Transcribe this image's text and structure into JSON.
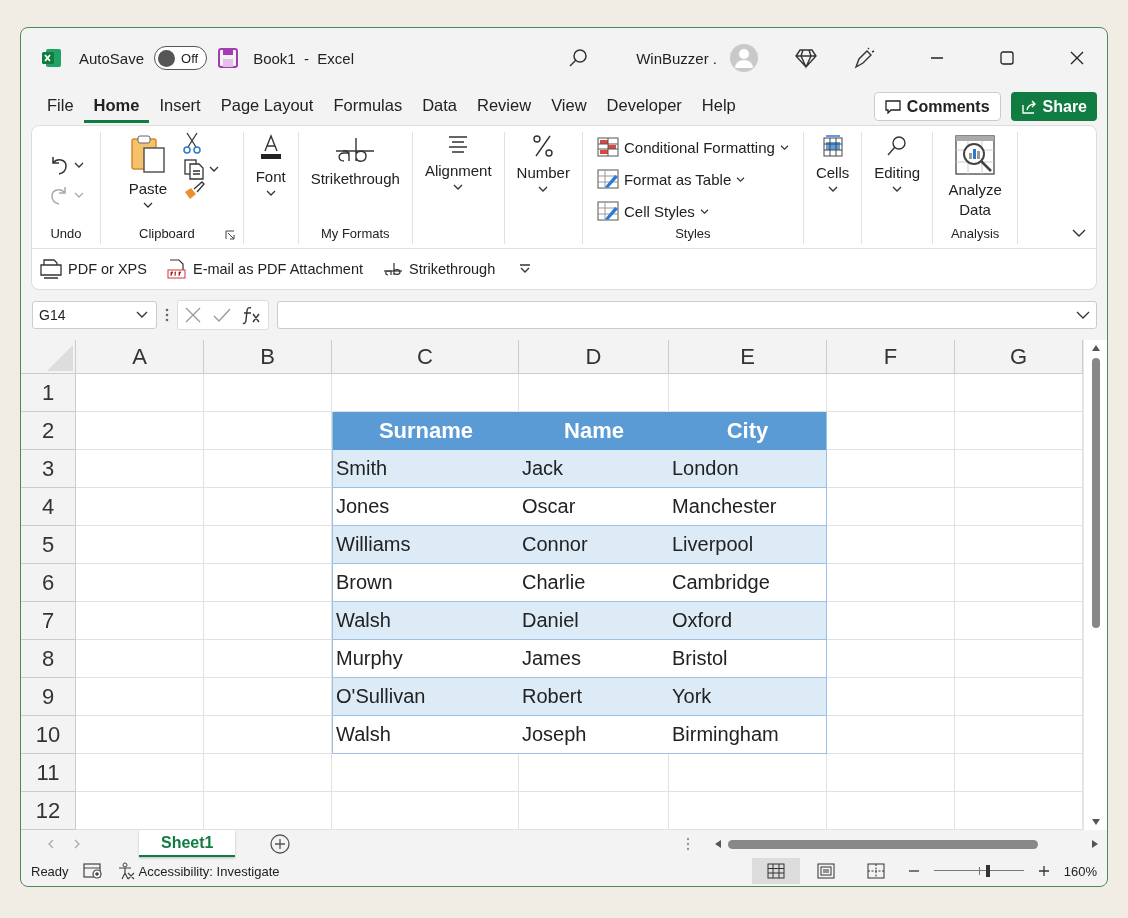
{
  "title_bar": {
    "autosave_label": "AutoSave",
    "autosave_on": false,
    "autosave_state": "Off",
    "document_title": "Book1  -  Excel",
    "account": "WinBuzzer ."
  },
  "menu_tabs": [
    {
      "label": "File",
      "selected": false
    },
    {
      "label": "Home",
      "selected": true
    },
    {
      "label": "Insert",
      "selected": false
    },
    {
      "label": "Page Layout",
      "selected": false
    },
    {
      "label": "Formulas",
      "selected": false
    },
    {
      "label": "Data",
      "selected": false
    },
    {
      "label": "Review",
      "selected": false
    },
    {
      "label": "View",
      "selected": false
    },
    {
      "label": "Developer",
      "selected": false
    },
    {
      "label": "Help",
      "selected": false
    }
  ],
  "comments_button": "Comments",
  "share_button": "Share",
  "ribbon": {
    "undo": {
      "label": "Undo"
    },
    "clipboard": {
      "paste": "Paste",
      "label": "Clipboard"
    },
    "font": {
      "button": "Font"
    },
    "my_formats": {
      "button": "Strikethrough",
      "label": "My Formats"
    },
    "alignment": {
      "button": "Alignment"
    },
    "number": {
      "button": "Number"
    },
    "styles": {
      "items": [
        "Conditional Formatting",
        "Format as Table",
        "Cell Styles"
      ],
      "label": "Styles"
    },
    "cells": {
      "button": "Cells"
    },
    "editing": {
      "button": "Editing"
    },
    "analysis": {
      "button": "Analyze Data",
      "label": "Analysis"
    }
  },
  "quick_access": [
    "PDF or XPS",
    "E-mail as PDF Attachment",
    "Strikethrough"
  ],
  "name_box": "G14",
  "columns": [
    "A",
    "B",
    "C",
    "D",
    "E",
    "F",
    "G"
  ],
  "rows": [
    {
      "number": "1"
    },
    {
      "number": "2",
      "kind": "table-header",
      "table": [
        "Surname",
        "Name",
        "City"
      ]
    },
    {
      "number": "3",
      "kind": "table-band",
      "table": [
        "Smith",
        "Jack",
        "London"
      ]
    },
    {
      "number": "4",
      "kind": "table-row",
      "table": [
        "Jones",
        "Oscar",
        "Manchester"
      ]
    },
    {
      "number": "5",
      "kind": "table-band",
      "table": [
        "Williams",
        "Connor",
        "Liverpool"
      ]
    },
    {
      "number": "6",
      "kind": "table-row",
      "table": [
        "Brown",
        "Charlie",
        "Cambridge"
      ]
    },
    {
      "number": "7",
      "kind": "table-band",
      "table": [
        "Walsh",
        "Daniel",
        "Oxford"
      ]
    },
    {
      "number": "8",
      "kind": "table-row",
      "table": [
        "Murphy",
        "James",
        "Bristol"
      ]
    },
    {
      "number": "9",
      "kind": "table-band",
      "table": [
        "O'Sullivan",
        "Robert",
        "York"
      ]
    },
    {
      "number": "10",
      "kind": "table-row",
      "table": [
        "Walsh",
        "Joseph",
        "Birmingham"
      ]
    },
    {
      "number": "11"
    },
    {
      "number": "12"
    }
  ],
  "sheet_tabs": [
    {
      "label": "Sheet1",
      "selected": true
    }
  ],
  "status_bar": {
    "status": "Ready",
    "accessibility": "Accessibility: Investigate",
    "views": [
      {
        "kind": "normal",
        "selected": true
      },
      {
        "kind": "page-layout",
        "selected": false
      },
      {
        "kind": "page-break",
        "selected": false
      }
    ],
    "zoom": {
      "level": 0.6,
      "reading": "160%"
    }
  }
}
